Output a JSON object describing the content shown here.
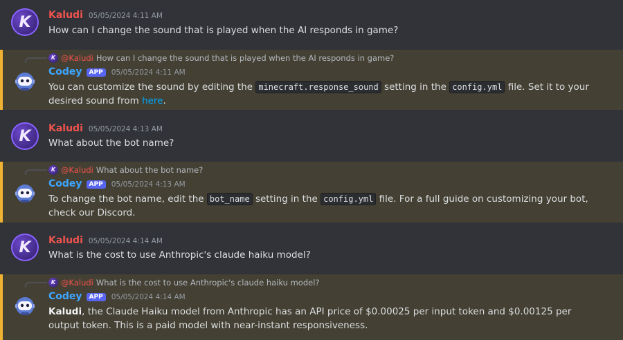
{
  "colors": {
    "background": "#313338",
    "mention_highlight": "#444033",
    "mention_bar": "#f0b232",
    "kaludi_name": "#f0534e",
    "codey_name": "#3ea6ff",
    "app_badge": "#5865f2",
    "link": "#00a8fc"
  },
  "messages": [
    {
      "author": "Kaludi",
      "avatar_icon": "kaludi-k-logo-icon",
      "avatar_letter": "K",
      "timestamp": "05/05/2024 4:11 AM",
      "text": "How can I change the sound that is played when the AI responds in game?"
    },
    {
      "author": "Codey",
      "badge": "APP",
      "avatar_icon": "robot-icon",
      "timestamp": "05/05/2024 4:11 AM",
      "reply_to": {
        "avatar_letter": "K",
        "mention": "@Kaludi",
        "text": "How can I change the sound that is played when the AI responds in game?"
      },
      "text_parts": {
        "p1": "You can customize the sound by editing the ",
        "code1": "minecraft.response_sound",
        "p2": " setting in the ",
        "code2": "config.yml",
        "p3": " file. Set it to your desired sound from ",
        "link": "here",
        "p4": "."
      }
    },
    {
      "author": "Kaludi",
      "avatar_icon": "kaludi-k-logo-icon",
      "avatar_letter": "K",
      "timestamp": "05/05/2024 4:13 AM",
      "text": "What about the bot name?"
    },
    {
      "author": "Codey",
      "badge": "APP",
      "avatar_icon": "robot-icon",
      "timestamp": "05/05/2024 4:13 AM",
      "reply_to": {
        "avatar_letter": "K",
        "mention": "@Kaludi",
        "text": "What about the bot name?"
      },
      "text_parts": {
        "p1": "To change the bot name, edit the ",
        "code1": "bot_name",
        "p2": " setting in the ",
        "code2": "config.yml",
        "p3": " file. For a full guide on customizing your bot, check our Discord."
      }
    },
    {
      "author": "Kaludi",
      "avatar_icon": "kaludi-k-logo-icon",
      "avatar_letter": "K",
      "timestamp": "05/05/2024 4:14 AM",
      "text": "What is the cost to use Anthropic's claude haiku model?"
    },
    {
      "author": "Codey",
      "badge": "APP",
      "avatar_icon": "robot-icon",
      "timestamp": "05/05/2024 4:14 AM",
      "reply_to": {
        "avatar_letter": "K",
        "mention": "@Kaludi",
        "text": "What is the cost to use Anthropic's claude haiku model?"
      },
      "text_parts": {
        "bold": "Kaludi",
        "p1": ", the Claude Haiku model from Anthropic has an API price of $0.00025 per input token and $0.00125 per output token. This is a paid model with near-instant responsiveness."
      }
    }
  ]
}
